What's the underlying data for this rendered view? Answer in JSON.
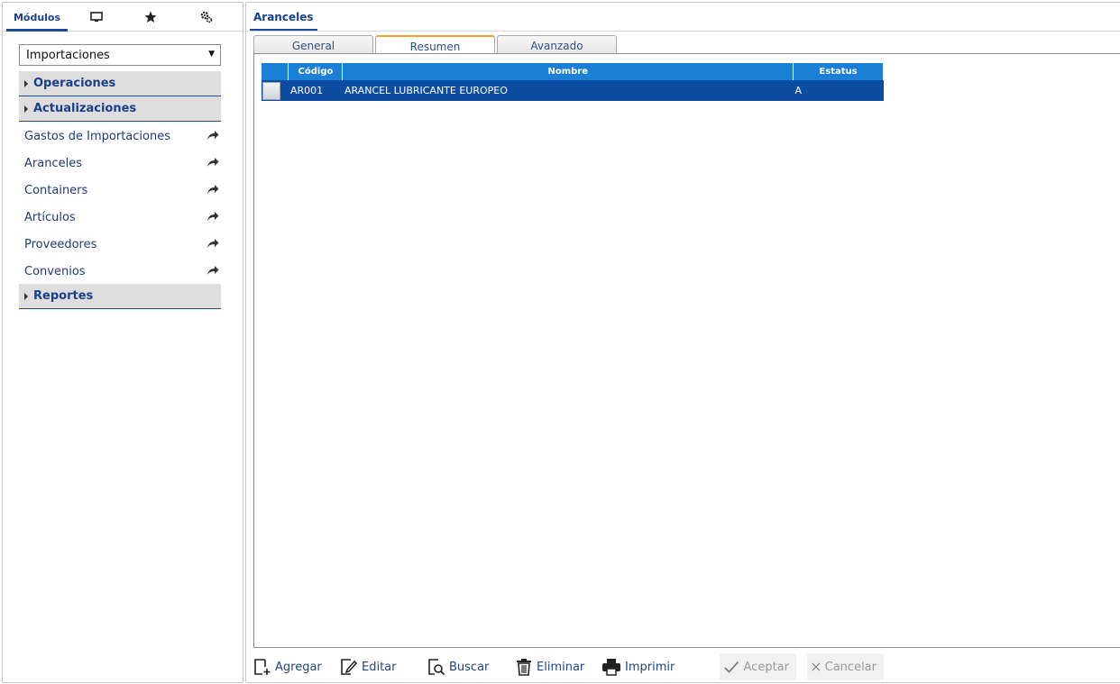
{
  "left_panel": {
    "tabs": {
      "modulos": "Módulos",
      "icons": [
        "monitor-icon",
        "star-icon",
        "gear-icon"
      ]
    },
    "module_select": {
      "value": "Importaciones"
    },
    "sections": {
      "operaciones": "Operaciones",
      "actualizaciones": "Actualizaciones",
      "reportes": "Reportes"
    },
    "items": [
      {
        "label": "Gastos de Importaciones"
      },
      {
        "label": "Aranceles"
      },
      {
        "label": "Containers"
      },
      {
        "label": "Artículos"
      },
      {
        "label": "Proveedores"
      },
      {
        "label": "Convenios"
      }
    ]
  },
  "right_panel": {
    "title": "Aranceles",
    "tabs": [
      {
        "label": "General"
      },
      {
        "label": "Resumen"
      },
      {
        "label": "Avanzado"
      }
    ],
    "active_tab": "Resumen",
    "grid": {
      "columns": [
        "",
        "Código",
        "Nombre",
        "Estatus"
      ],
      "rows": [
        {
          "codigo": "AR001",
          "nombre": "ARANCEL LUBRICANTE EUROPEO",
          "estatus": "A"
        }
      ]
    },
    "toolbar": {
      "agregar": "Agregar",
      "editar": "Editar",
      "buscar": "Buscar",
      "eliminar": "Eliminar",
      "imprimir": "Imprimir",
      "aceptar": "Aceptar",
      "cancelar": "Cancelar"
    }
  },
  "colors": {
    "accent": "#1b4b9b",
    "grid_header": "#1c7fd6",
    "grid_row_selected": "#0c4da2",
    "active_tab_top": "#f0a030"
  }
}
